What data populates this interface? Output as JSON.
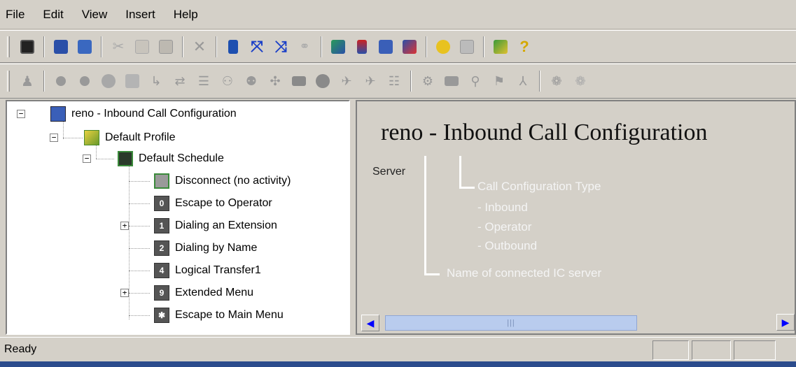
{
  "menu": [
    {
      "label": "File"
    },
    {
      "label": "Edit"
    },
    {
      "label": "View"
    },
    {
      "label": "Insert"
    },
    {
      "label": "Help"
    }
  ],
  "toolbar1_icons": [
    "save-icon",
    "open-config-icon",
    "refresh-icon",
    "cut-icon",
    "copy-icon",
    "paste-icon",
    "delete-icon",
    "sort-icon",
    "expand-icon",
    "collapse-icon",
    "link-icon",
    "network-icon",
    "server-icon",
    "computer-icon",
    "connect-icon",
    "key-icon",
    "grid-icon",
    "properties-icon",
    "help-icon"
  ],
  "toolbar2_icons": [
    "person-icon",
    "record-icon",
    "stop-icon",
    "group-icon",
    "table-icon",
    "transfer-icon",
    "route-icon",
    "queue-icon",
    "agent-icon",
    "workgroup-icon",
    "dial-icon",
    "menu-icon",
    "circle-icon",
    "play-icon",
    "audio-icon",
    "list-icon",
    "extension-icon",
    "menu2-icon",
    "lookup-icon",
    "forward-icon",
    "branch-icon",
    "settings-icon",
    "gear-icon"
  ],
  "tree": {
    "server": "reno - Inbound Call Configuration",
    "profile": "Default Profile",
    "schedule": "Default Schedule",
    "items": [
      {
        "key": "",
        "label": "Disconnect (no activity)"
      },
      {
        "key": "0",
        "label": "Escape to Operator"
      },
      {
        "key": "1",
        "label": "Dialing an Extension"
      },
      {
        "key": "2",
        "label": "Dialing by Name"
      },
      {
        "key": "4",
        "label": "Logical Transfer1"
      },
      {
        "key": "9",
        "label": "Extended Menu"
      },
      {
        "key": "✱",
        "label": "Escape to Main Menu"
      }
    ]
  },
  "detail": {
    "title": "reno - Inbound Call Configuration",
    "server_label": "Server",
    "type_heading": "Call Configuration Type",
    "types": [
      "- Inbound",
      "- Operator",
      "- Outbound"
    ],
    "server_note": "Name of connected IC server"
  },
  "status": {
    "text": "Ready"
  },
  "colors": {
    "annotation": "#f4f4f4",
    "scroll_thumb": "#b9ccee",
    "highlight": "#ffffff"
  }
}
